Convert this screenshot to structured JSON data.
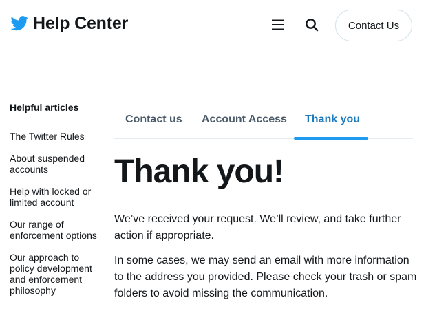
{
  "header": {
    "brand": "Help Center",
    "contact_label": "Contact Us",
    "icons": {
      "logo": "twitter-bird-icon",
      "menu": "hamburger-menu-icon",
      "search": "search-icon"
    },
    "brand_color": "#1d9bf0"
  },
  "sidebar": {
    "heading": "Helpful articles",
    "items": [
      {
        "label": "The Twitter Rules"
      },
      {
        "label": "About suspended accounts"
      },
      {
        "label": "Help with locked or limited account"
      },
      {
        "label": "Our range of enforcement options"
      },
      {
        "label": "Our approach to policy development and enforcement philosophy"
      }
    ]
  },
  "tabs": [
    {
      "label": "Contact us"
    },
    {
      "label": "Account Access"
    },
    {
      "label": "Thank you",
      "active": true
    }
  ],
  "main": {
    "title": "Thank you!",
    "paragraphs": [
      "We’ve received your request. We’ll review, and take further action if appropriate.",
      "In some cases, we may send an email with more information to the address you provided. Please check your trash or spam folders to avoid missing the communication."
    ]
  },
  "colors": {
    "accent": "#1d9bf0",
    "active_tab_text": "#1d7bbf",
    "tab_text": "#4a5a68",
    "text": "#14171a"
  }
}
